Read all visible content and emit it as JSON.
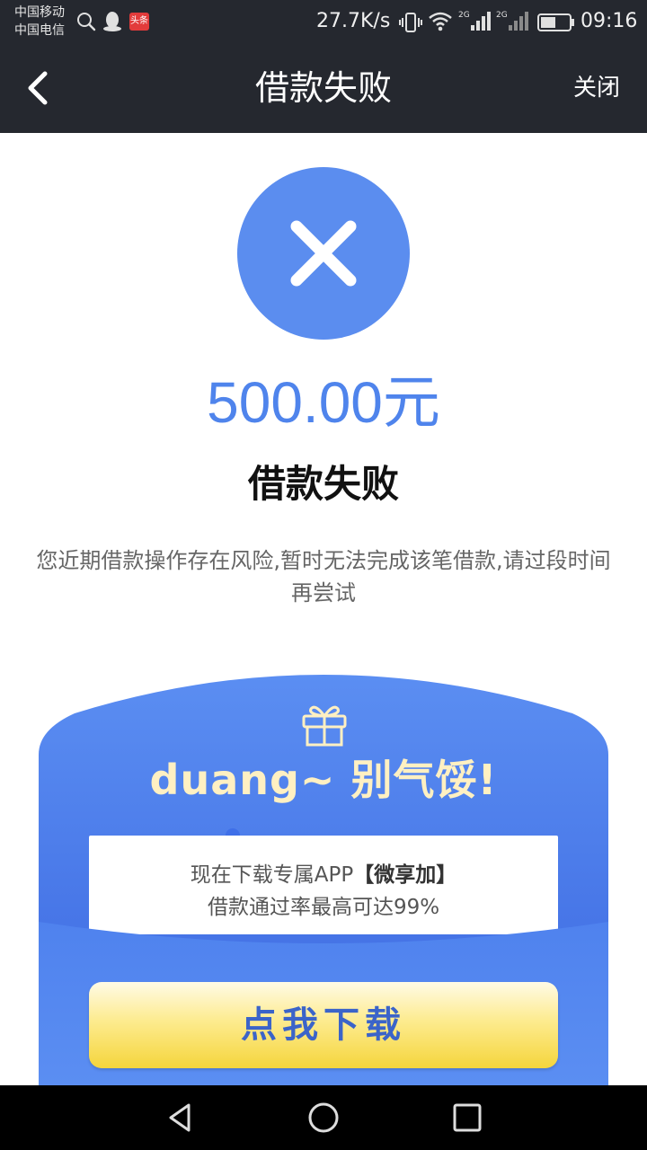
{
  "status_bar": {
    "carrier_1": "中国移动",
    "carrier_2": "中国电信",
    "toutiao_badge": "头条",
    "net_speed": "27.7K/s",
    "sim1_network": "2G",
    "sim2_network": "2G",
    "time": "09:16",
    "icons": [
      "search-icon",
      "qq-icon",
      "toutiao-icon",
      "vibrate-icon",
      "wifi-icon",
      "signal-icon",
      "battery-icon"
    ]
  },
  "nav": {
    "title": "借款失败",
    "close_label": "关闭",
    "back_icon": "chevron-left-icon",
    "background": "#25282f"
  },
  "result": {
    "icon": "close-x-icon",
    "amount": "500.00元",
    "status": "借款失败",
    "message": "您近期借款操作存在风险,暂时无法完成该笔借款,请过段时间再尝试",
    "accent_color": "#4f84ec"
  },
  "promo": {
    "icon": "gift-icon",
    "headline": "duang~ 别气馁!",
    "line1_prefix": "现在下载专属APP",
    "line1_app": "【微享加】",
    "line2": "借款通过率最高可达99%",
    "button_label": "点我下载",
    "card_color": "#4a7ae8",
    "button_color": "#f5d53c"
  },
  "system_nav": {
    "icons": [
      "back-triangle-icon",
      "home-circle-icon",
      "recents-square-icon"
    ]
  }
}
